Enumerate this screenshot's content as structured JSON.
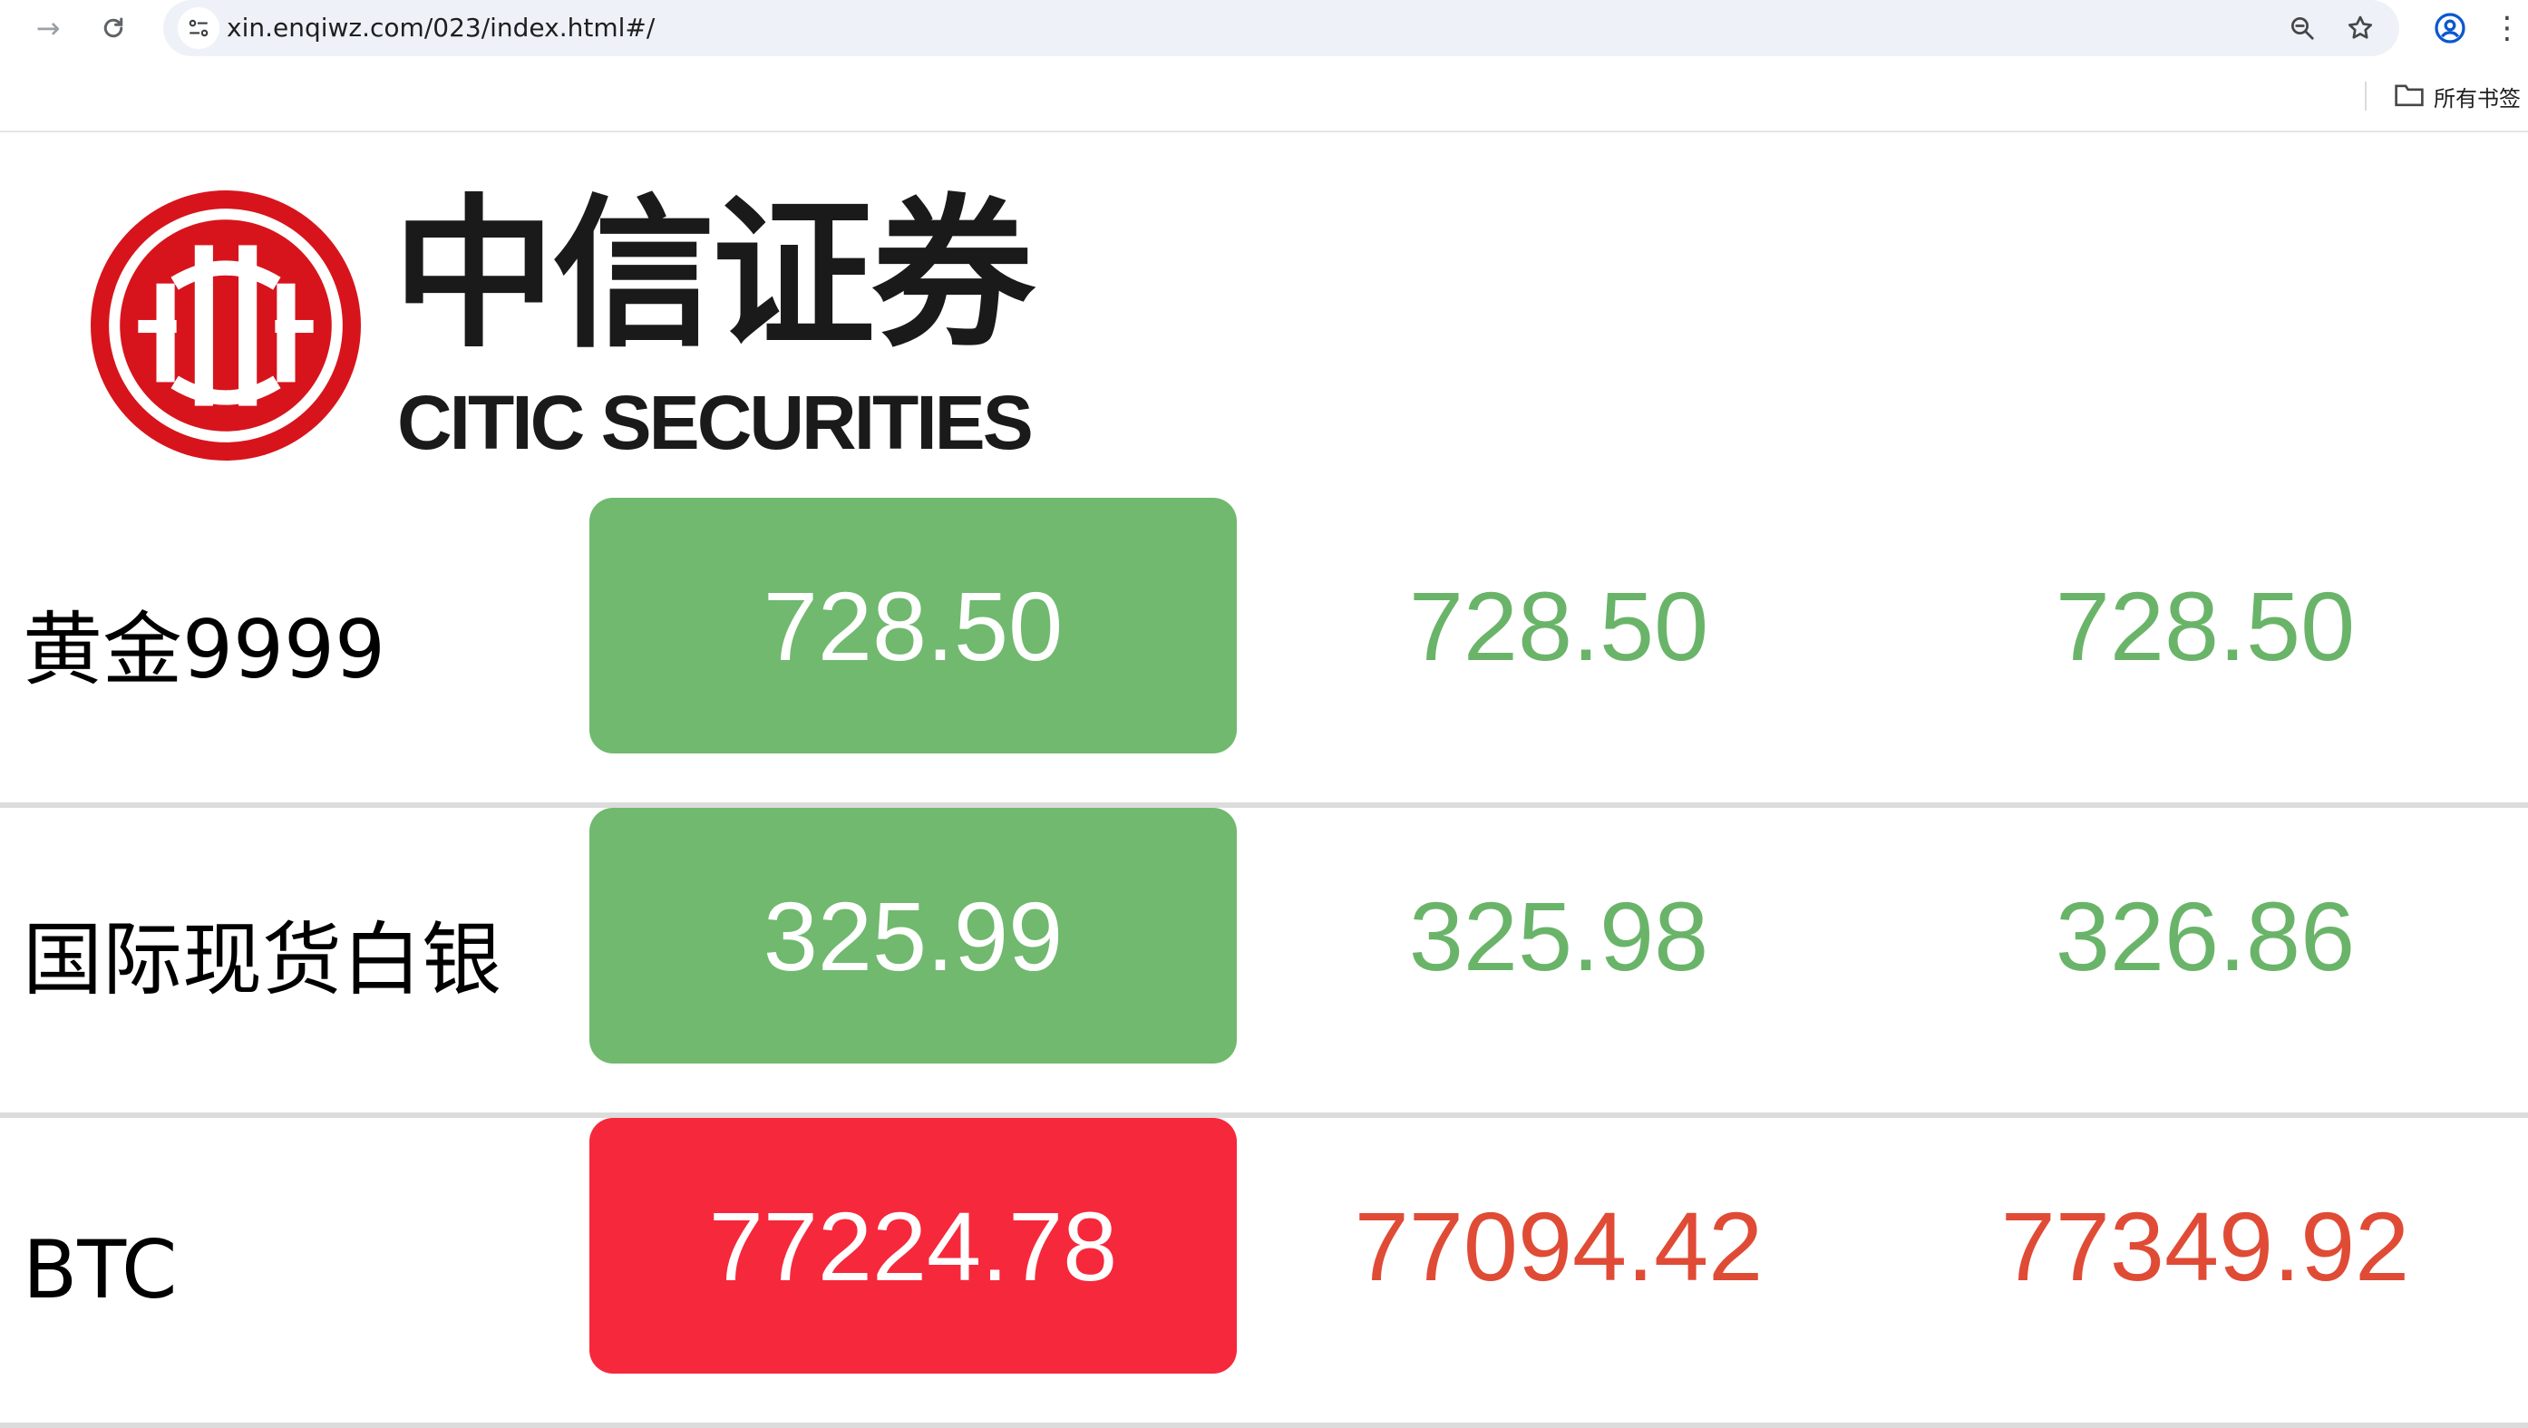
{
  "browser": {
    "url": "xin.enqiwz.com/023/index.html#/",
    "bookmarks_folder_label": "所有书签",
    "icons": {
      "forward": "arrow-right-icon",
      "reload": "reload-icon",
      "site_info": "site-settings-icon",
      "zoom": "zoom-icon",
      "bookmark": "star-icon",
      "profile": "profile-icon",
      "menu": "more-vertical-icon",
      "folder": "folder-icon"
    }
  },
  "logo": {
    "chinese": "中信证券",
    "english": "CITIC SECURITIES",
    "brand_color": "#d7141c"
  },
  "colors": {
    "up_green": "#70b96f",
    "down_red": "#f6283c",
    "low_high_green": "#6ab46a",
    "low_high_red": "#e04b36"
  },
  "rows": [
    {
      "name": "黄金9999",
      "price": "728.50",
      "low": "728.50",
      "high": "728.50",
      "trend": "up"
    },
    {
      "name": "国际现货白银",
      "price": "325.99",
      "low": "325.98",
      "high": "326.86",
      "trend": "up"
    },
    {
      "name": "BTC",
      "price": "77224.78",
      "low": "77094.42",
      "high": "77349.92",
      "trend": "down"
    }
  ]
}
